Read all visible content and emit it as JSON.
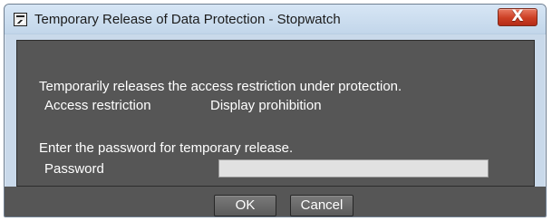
{
  "window": {
    "title": "Temporary Release of Data Protection - Stopwatch",
    "close_label": "X"
  },
  "content": {
    "description": "Temporarily releases the access restriction under protection.",
    "access_restriction_label": "Access restriction",
    "access_restriction_value": "Display prohibition",
    "password_prompt": "Enter the password for temporary release.",
    "password_label": "Password",
    "password_value": "",
    "password_placeholder": ""
  },
  "buttons": {
    "ok": "OK",
    "cancel": "Cancel"
  },
  "colors": {
    "panel": "#565656",
    "window_frame": "#c9d9ea",
    "close_button": "#cc3f24",
    "text": "#ffffff"
  }
}
